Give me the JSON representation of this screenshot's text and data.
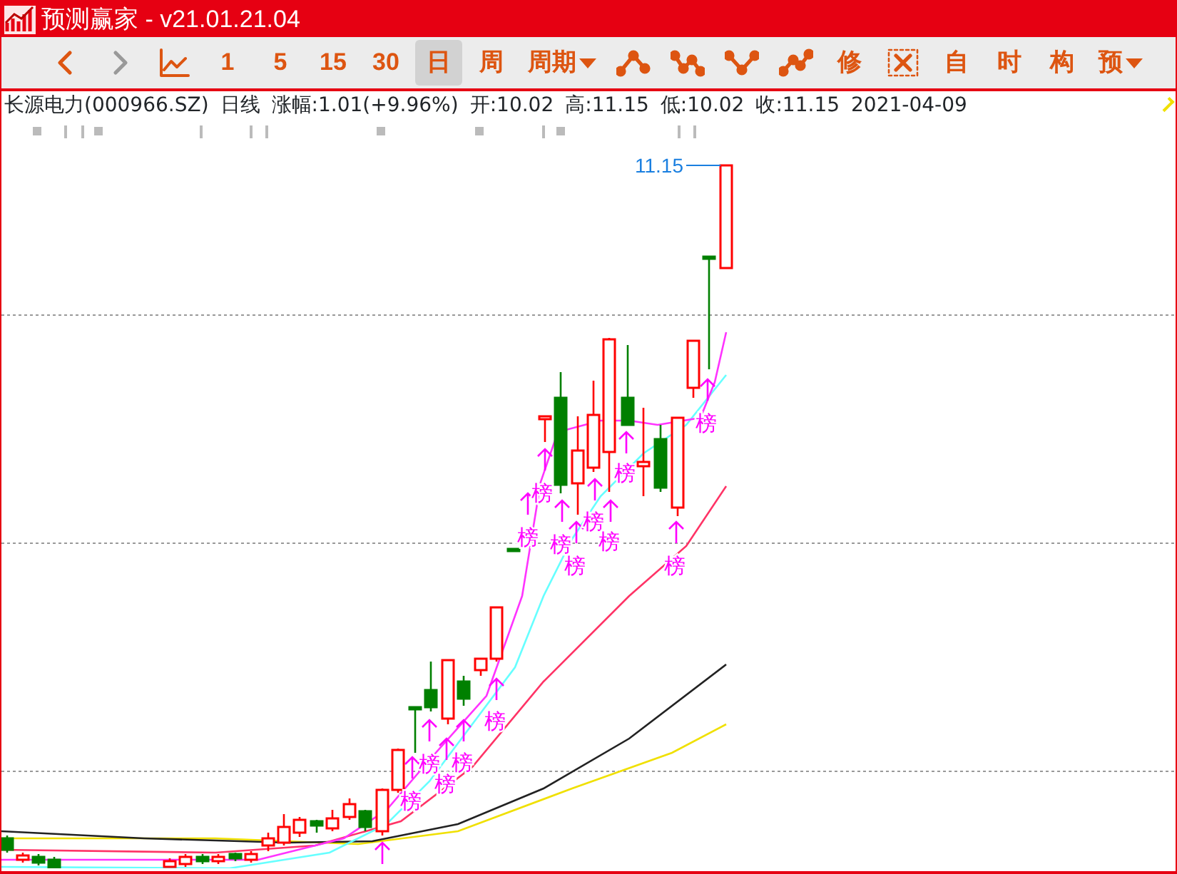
{
  "window": {
    "title": "预测赢家 - v21.01.21.04"
  },
  "toolbar": [
    {
      "kind": "back"
    },
    {
      "kind": "forward"
    },
    {
      "kind": "trend"
    },
    {
      "kind": "period",
      "label": "1",
      "selected": false
    },
    {
      "kind": "period",
      "label": "5",
      "selected": false
    },
    {
      "kind": "period",
      "label": "15",
      "selected": false
    },
    {
      "kind": "period",
      "label": "30",
      "selected": false
    },
    {
      "kind": "period",
      "label": "日",
      "selected": true
    },
    {
      "kind": "period",
      "label": "周",
      "selected": false
    },
    {
      "kind": "menu",
      "label": "周期"
    },
    {
      "kind": "draw_peak"
    },
    {
      "kind": "draw_zigzag"
    },
    {
      "kind": "draw_valley"
    },
    {
      "kind": "draw_rise"
    },
    {
      "kind": "tool",
      "label": "修"
    },
    {
      "kind": "cancel"
    },
    {
      "kind": "tool",
      "label": "自"
    },
    {
      "kind": "tool",
      "label": "时"
    },
    {
      "kind": "tool",
      "label": "构"
    },
    {
      "kind": "menu",
      "label": "预"
    }
  ],
  "info": {
    "stock": "长源电力(000966.SZ)",
    "period": "日线",
    "change": "涨幅:1.01(+9.96%)",
    "open": "开:10.02",
    "high": "高:11.15",
    "low": "低:10.02",
    "close": "收:11.15",
    "date": "2021-04-09"
  },
  "chart": {
    "price_label": "11.15",
    "rank_labels": [
      "榜",
      "榜",
      "榜",
      "榜",
      "榜",
      "榜",
      "榜",
      "榜",
      "榜",
      "榜",
      "榜",
      "榜",
      "榜",
      "榜"
    ]
  }
}
